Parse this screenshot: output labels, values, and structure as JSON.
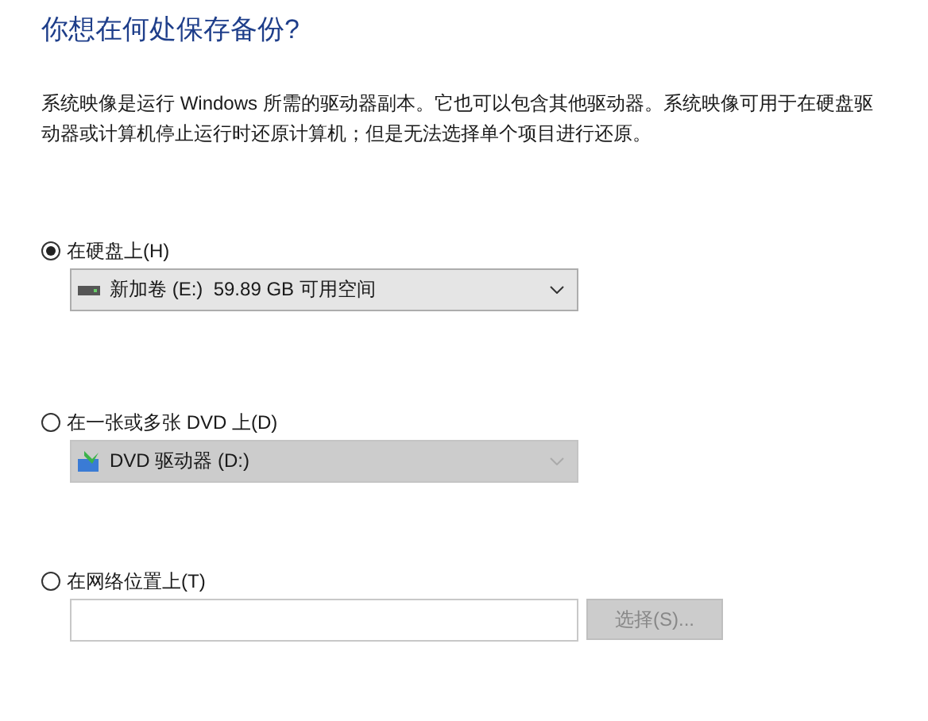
{
  "title": "你想在何处保存备份?",
  "description": "系统映像是运行 Windows 所需的驱动器副本。它也可以包含其他驱动器。系统映像可用于在硬盘驱动器或计算机停止运行时还原计算机；但是无法选择单个项目进行还原。",
  "options": [
    {
      "kind": "drive",
      "label": "在硬盘上(H)",
      "selected": true,
      "dropdown": {
        "value": "新加卷 (E:)  59.89 GB 可用空间",
        "disabled": false
      }
    },
    {
      "kind": "drive",
      "label": "在一张或多张 DVD 上(D)",
      "selected": false,
      "dropdown": {
        "value": "DVD 驱动器 (D:)",
        "disabled": true
      }
    },
    {
      "kind": "network",
      "label": "在网络位置上(T)",
      "selected": false,
      "button": {
        "label": "选择(S)...",
        "disabled": true
      }
    }
  ]
}
